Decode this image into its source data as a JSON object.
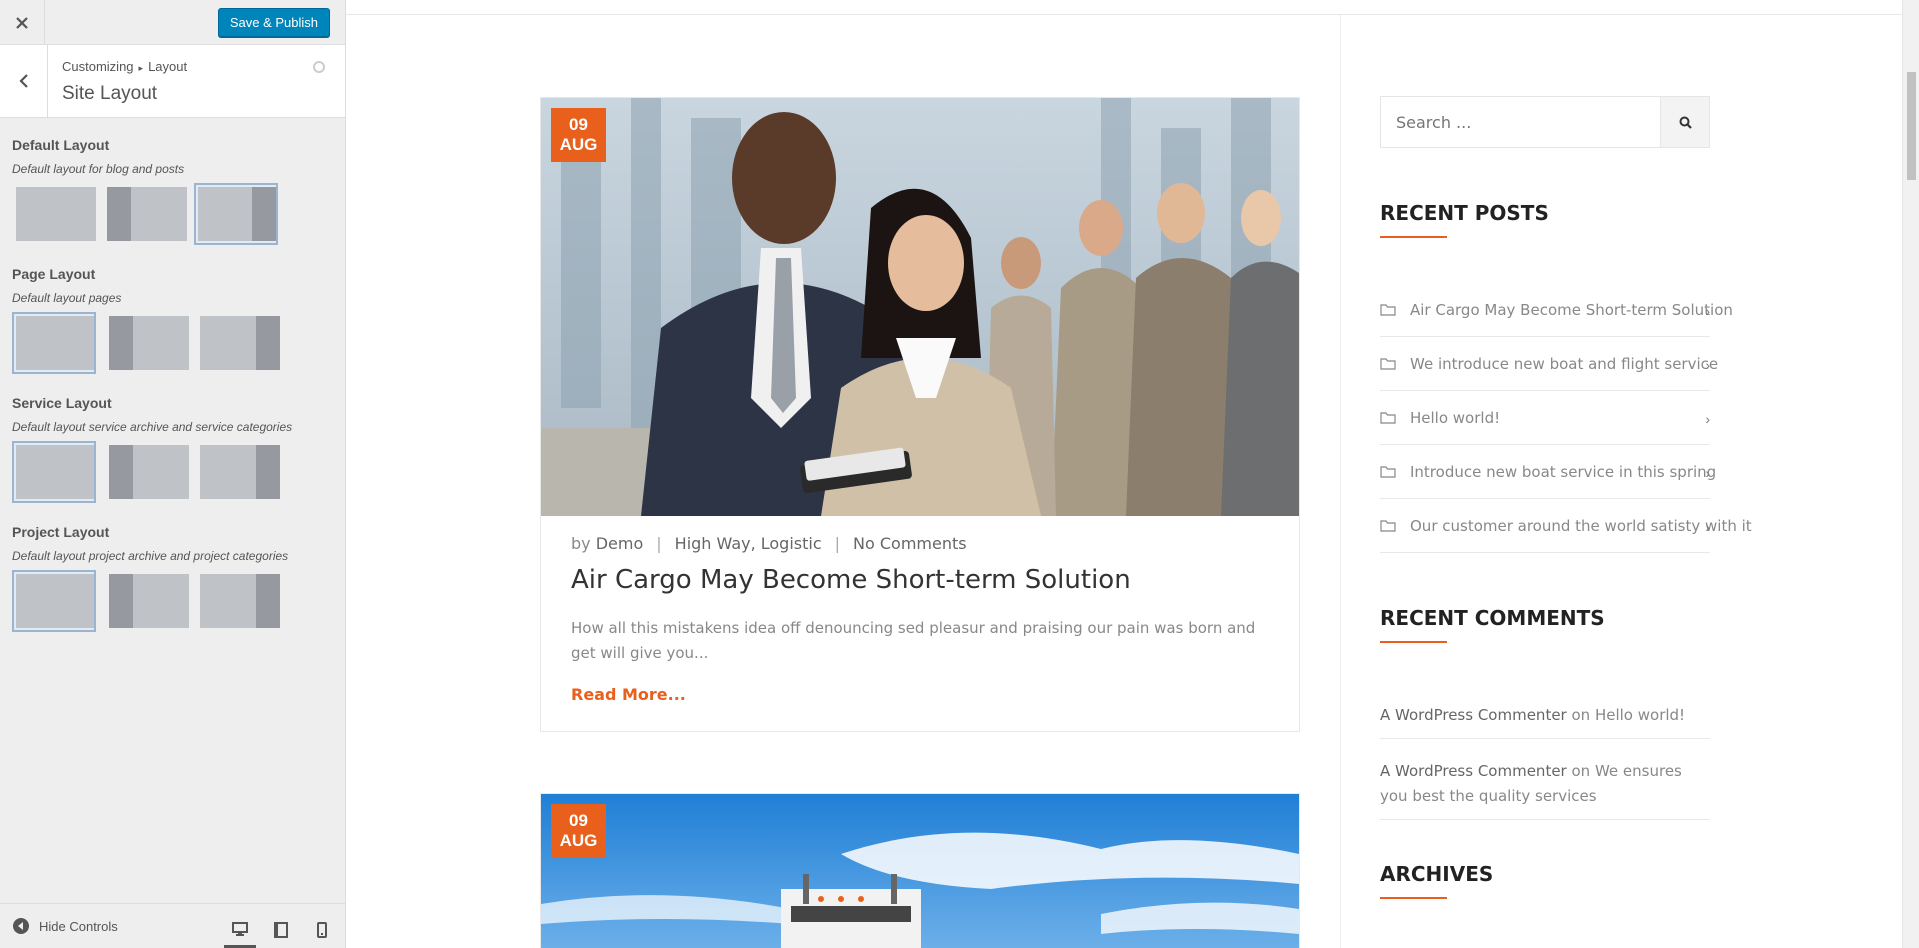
{
  "customizer": {
    "close_icon": "close-icon",
    "publish_label": "Save & Publish",
    "breadcrumb": {
      "root": "Customizing",
      "separator": "▸",
      "current": "Layout"
    },
    "section_title": "Site Layout",
    "settings": [
      {
        "title": "Default Layout",
        "description": "Default layout for blog and posts",
        "options": [
          "full-width",
          "left-sidebar",
          "right-sidebar"
        ],
        "selected": "right-sidebar"
      },
      {
        "title": "Page Layout",
        "description": "Default layout pages",
        "options": [
          "full-width",
          "left-sidebar",
          "right-sidebar"
        ],
        "selected": "full-width"
      },
      {
        "title": "Service Layout",
        "description": "Default layout service archive and service categories",
        "options": [
          "full-width",
          "left-sidebar",
          "right-sidebar"
        ],
        "selected": "full-width"
      },
      {
        "title": "Project Layout",
        "description": "Default layout project archive and project categories",
        "options": [
          "full-width",
          "left-sidebar",
          "right-sidebar"
        ],
        "selected": "full-width"
      }
    ],
    "footer": {
      "hide_controls_label": "Hide Controls",
      "devices": [
        "desktop-icon",
        "tablet-icon",
        "mobile-icon"
      ],
      "active_device": "desktop"
    }
  },
  "preview": {
    "posts": [
      {
        "date_day": "09",
        "date_month": "AUG",
        "meta_by": "by",
        "author": "Demo",
        "categories": "High Way, Logistic",
        "comments": "No Comments",
        "title": "Air Cargo May Become Short-term Solution",
        "excerpt": "How all this mistakens idea off denouncing sed pleasur and praising our pain was born and get will give you...",
        "read_more": "Read More...",
        "image": "business-people-photo"
      },
      {
        "date_day": "09",
        "date_month": "AUG",
        "image": "truck-sky-photo"
      }
    ],
    "sidebar": {
      "search_placeholder": "Search ...",
      "recent_posts_title": "RECENT POSTS",
      "recent_posts": [
        "Air Cargo May Become Short-term Solution",
        "We introduce new boat and flight service",
        "Hello world!",
        "Introduce new boat service in this spring",
        "Our customer around the world satisty with it"
      ],
      "recent_comments_title": "RECENT COMMENTS",
      "recent_comments": [
        {
          "author": "A WordPress Commenter",
          "on": "on",
          "post": "Hello world!"
        },
        {
          "author": "A WordPress Commenter",
          "on": "on",
          "post": "We ensures you best the quality services"
        }
      ],
      "archives_title": "ARCHIVES"
    },
    "accent_color": "#e8601c"
  }
}
